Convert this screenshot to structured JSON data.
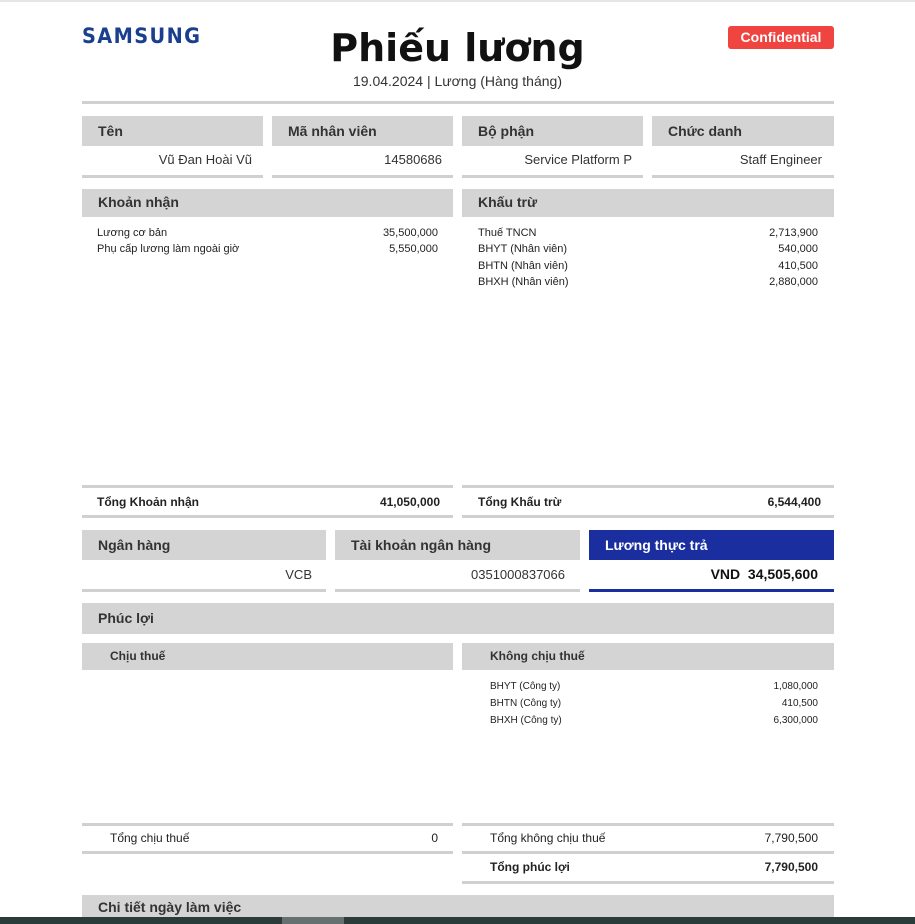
{
  "header": {
    "logo": "SAMSUNG",
    "title": "Phiếu lương",
    "subtitle": "19.04.2024 | Lương (Hàng tháng)",
    "badge": "Confidential"
  },
  "employee": {
    "name_label": "Tên",
    "name": "Vũ Đan Hoài Vũ",
    "id_label": "Mã nhân viên",
    "id": "14580686",
    "dept_label": "Bộ phận",
    "dept": "Service Platform P",
    "title_label": "Chức danh",
    "title": "Staff Engineer"
  },
  "earnings": {
    "header": "Khoản nhận",
    "items": [
      {
        "label": "Lương cơ bản",
        "value": "35,500,000"
      },
      {
        "label": "Phụ cấp lương làm ngoài giờ",
        "value": "5,550,000"
      }
    ],
    "total_label": "Tổng Khoản nhận",
    "total": "41,050,000"
  },
  "deductions": {
    "header": "Khấu trừ",
    "items": [
      {
        "label": "Thuế TNCN",
        "value": "2,713,900"
      },
      {
        "label": "BHYT (Nhân viên)",
        "value": "540,000"
      },
      {
        "label": "BHTN (Nhân viên)",
        "value": "410,500"
      },
      {
        "label": "BHXH (Nhân viên)",
        "value": "2,880,000"
      }
    ],
    "total_label": "Tổng Khấu trừ",
    "total": "6,544,400"
  },
  "payment": {
    "bank_label": "Ngân hàng",
    "bank": "VCB",
    "account_label": "Tài khoản ngân hàng",
    "account": "0351000837066",
    "net_label": "Lương thực trả",
    "currency": "VND",
    "net": "34,505,600"
  },
  "benefits": {
    "header": "Phúc lợi",
    "taxable_header": "Chịu thuế",
    "nontaxable_header": "Không chịu thuế",
    "nontaxable_items": [
      {
        "label": "BHYT (Công ty)",
        "value": "1,080,000"
      },
      {
        "label": "BHTN (Công ty)",
        "value": "410,500"
      },
      {
        "label": "BHXH (Công ty)",
        "value": "6,300,000"
      }
    ],
    "taxable_total_label": "Tổng chịu thuế",
    "taxable_total": "0",
    "nontaxable_total_label": "Tổng không chịu thuế",
    "nontaxable_total": "7,790,500",
    "benefits_total_label": "Tổng phúc lợi",
    "benefits_total": "7,790,500"
  },
  "workdays": {
    "header": "Chi tiết ngày làm việc"
  },
  "colors": {
    "brand": "#1a3f8f",
    "badge": "#ef4440",
    "net_pay": "#1a2ea0"
  }
}
